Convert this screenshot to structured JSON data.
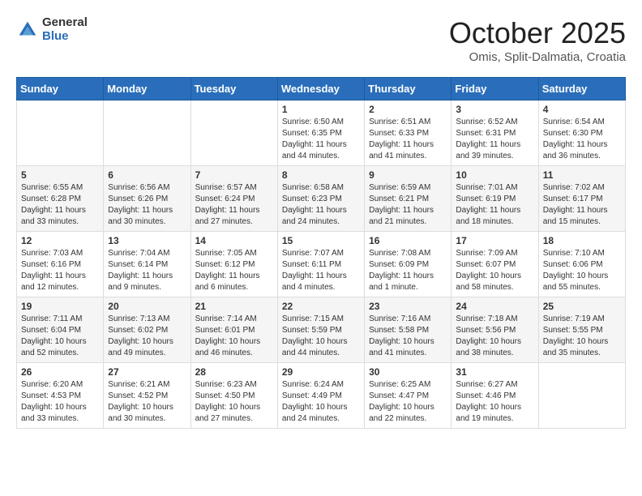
{
  "header": {
    "logo_general": "General",
    "logo_blue": "Blue",
    "month_title": "October 2025",
    "subtitle": "Omis, Split-Dalmatia, Croatia"
  },
  "weekdays": [
    "Sunday",
    "Monday",
    "Tuesday",
    "Wednesday",
    "Thursday",
    "Friday",
    "Saturday"
  ],
  "weeks": [
    [
      null,
      null,
      null,
      {
        "day": 1,
        "sunrise": "6:50 AM",
        "sunset": "6:35 PM",
        "daylight": "11 hours and 44 minutes."
      },
      {
        "day": 2,
        "sunrise": "6:51 AM",
        "sunset": "6:33 PM",
        "daylight": "11 hours and 41 minutes."
      },
      {
        "day": 3,
        "sunrise": "6:52 AM",
        "sunset": "6:31 PM",
        "daylight": "11 hours and 39 minutes."
      },
      {
        "day": 4,
        "sunrise": "6:54 AM",
        "sunset": "6:30 PM",
        "daylight": "11 hours and 36 minutes."
      }
    ],
    [
      {
        "day": 5,
        "sunrise": "6:55 AM",
        "sunset": "6:28 PM",
        "daylight": "11 hours and 33 minutes."
      },
      {
        "day": 6,
        "sunrise": "6:56 AM",
        "sunset": "6:26 PM",
        "daylight": "11 hours and 30 minutes."
      },
      {
        "day": 7,
        "sunrise": "6:57 AM",
        "sunset": "6:24 PM",
        "daylight": "11 hours and 27 minutes."
      },
      {
        "day": 8,
        "sunrise": "6:58 AM",
        "sunset": "6:23 PM",
        "daylight": "11 hours and 24 minutes."
      },
      {
        "day": 9,
        "sunrise": "6:59 AM",
        "sunset": "6:21 PM",
        "daylight": "11 hours and 21 minutes."
      },
      {
        "day": 10,
        "sunrise": "7:01 AM",
        "sunset": "6:19 PM",
        "daylight": "11 hours and 18 minutes."
      },
      {
        "day": 11,
        "sunrise": "7:02 AM",
        "sunset": "6:17 PM",
        "daylight": "11 hours and 15 minutes."
      }
    ],
    [
      {
        "day": 12,
        "sunrise": "7:03 AM",
        "sunset": "6:16 PM",
        "daylight": "11 hours and 12 minutes."
      },
      {
        "day": 13,
        "sunrise": "7:04 AM",
        "sunset": "6:14 PM",
        "daylight": "11 hours and 9 minutes."
      },
      {
        "day": 14,
        "sunrise": "7:05 AM",
        "sunset": "6:12 PM",
        "daylight": "11 hours and 6 minutes."
      },
      {
        "day": 15,
        "sunrise": "7:07 AM",
        "sunset": "6:11 PM",
        "daylight": "11 hours and 4 minutes."
      },
      {
        "day": 16,
        "sunrise": "7:08 AM",
        "sunset": "6:09 PM",
        "daylight": "11 hours and 1 minute."
      },
      {
        "day": 17,
        "sunrise": "7:09 AM",
        "sunset": "6:07 PM",
        "daylight": "10 hours and 58 minutes."
      },
      {
        "day": 18,
        "sunrise": "7:10 AM",
        "sunset": "6:06 PM",
        "daylight": "10 hours and 55 minutes."
      }
    ],
    [
      {
        "day": 19,
        "sunrise": "7:11 AM",
        "sunset": "6:04 PM",
        "daylight": "10 hours and 52 minutes."
      },
      {
        "day": 20,
        "sunrise": "7:13 AM",
        "sunset": "6:02 PM",
        "daylight": "10 hours and 49 minutes."
      },
      {
        "day": 21,
        "sunrise": "7:14 AM",
        "sunset": "6:01 PM",
        "daylight": "10 hours and 46 minutes."
      },
      {
        "day": 22,
        "sunrise": "7:15 AM",
        "sunset": "5:59 PM",
        "daylight": "10 hours and 44 minutes."
      },
      {
        "day": 23,
        "sunrise": "7:16 AM",
        "sunset": "5:58 PM",
        "daylight": "10 hours and 41 minutes."
      },
      {
        "day": 24,
        "sunrise": "7:18 AM",
        "sunset": "5:56 PM",
        "daylight": "10 hours and 38 minutes."
      },
      {
        "day": 25,
        "sunrise": "7:19 AM",
        "sunset": "5:55 PM",
        "daylight": "10 hours and 35 minutes."
      }
    ],
    [
      {
        "day": 26,
        "sunrise": "6:20 AM",
        "sunset": "4:53 PM",
        "daylight": "10 hours and 33 minutes."
      },
      {
        "day": 27,
        "sunrise": "6:21 AM",
        "sunset": "4:52 PM",
        "daylight": "10 hours and 30 minutes."
      },
      {
        "day": 28,
        "sunrise": "6:23 AM",
        "sunset": "4:50 PM",
        "daylight": "10 hours and 27 minutes."
      },
      {
        "day": 29,
        "sunrise": "6:24 AM",
        "sunset": "4:49 PM",
        "daylight": "10 hours and 24 minutes."
      },
      {
        "day": 30,
        "sunrise": "6:25 AM",
        "sunset": "4:47 PM",
        "daylight": "10 hours and 22 minutes."
      },
      {
        "day": 31,
        "sunrise": "6:27 AM",
        "sunset": "4:46 PM",
        "daylight": "10 hours and 19 minutes."
      },
      null
    ]
  ]
}
